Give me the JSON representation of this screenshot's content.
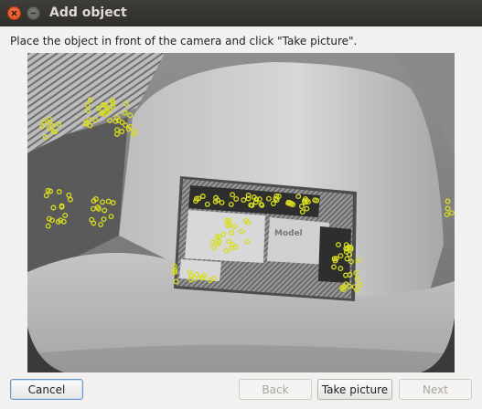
{
  "window": {
    "title": "Add object"
  },
  "instruction": "Place the object in front of the camera and click \"Take picture\".",
  "camera": {
    "card_text": "Model"
  },
  "buttons": {
    "cancel": "Cancel",
    "back": "Back",
    "take_picture": "Take picture",
    "next": "Next"
  },
  "colors": {
    "titlebar": "#3c3b37",
    "close": "#df4b16",
    "feature_points": "#d9dd1f",
    "focus_border": "#6b98c9"
  }
}
